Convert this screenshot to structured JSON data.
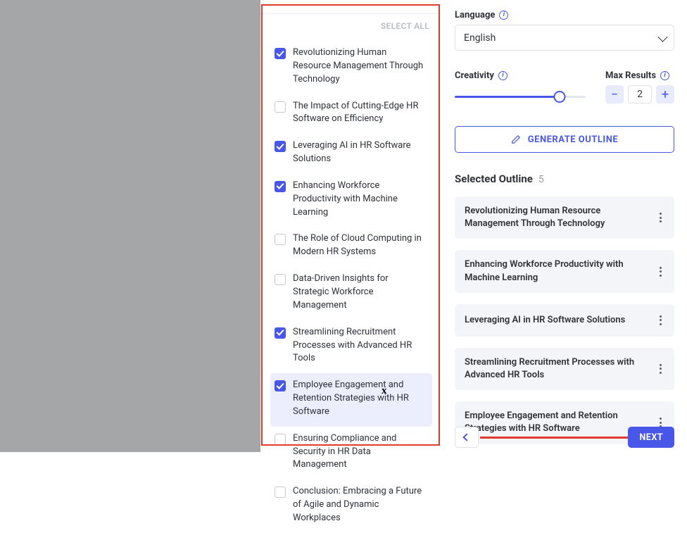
{
  "mid": {
    "select_all": "SELECT ALL",
    "topics": [
      {
        "label": "Revolutionizing Human Resource Management Through Technology",
        "checked": true
      },
      {
        "label": "The Impact of Cutting-Edge HR Software on Efficiency",
        "checked": false
      },
      {
        "label": "Leveraging AI in HR Software Solutions",
        "checked": true
      },
      {
        "label": "Enhancing Workforce Productivity with Machine Learning",
        "checked": true
      },
      {
        "label": "The Role of Cloud Computing in Modern HR Systems",
        "checked": false
      },
      {
        "label": "Data-Driven Insights for Strategic Workforce Management",
        "checked": false
      },
      {
        "label": "Streamlining Recruitment Processes with Advanced HR Tools",
        "checked": true
      },
      {
        "label": "Employee Engagement and Retention Strategies with HR Software",
        "checked": true,
        "selected": true
      },
      {
        "label": "Ensuring Compliance and Security in HR Data Management",
        "checked": false
      },
      {
        "label": "Conclusion: Embracing a Future of Agile and Dynamic Workplaces",
        "checked": false
      }
    ]
  },
  "right": {
    "language_label": "Language",
    "language_value": "English",
    "creativity_label": "Creativity",
    "creativity_value": 0.8,
    "max_results_label": "Max Results",
    "max_results_value": "2",
    "generate_label": "GENERATE OUTLINE",
    "selected_outline_label": "Selected Outline",
    "selected_outline_count": "5",
    "outline": [
      "Revolutionizing Human Resource Management Through Technology",
      "Enhancing Workforce Productivity with Machine Learning",
      "Leveraging AI in HR Software Solutions",
      "Streamlining Recruitment Processes with Advanced HR Tools",
      "Employee Engagement and Retention Strategies with HR Software"
    ],
    "next_label": "NEXT"
  }
}
